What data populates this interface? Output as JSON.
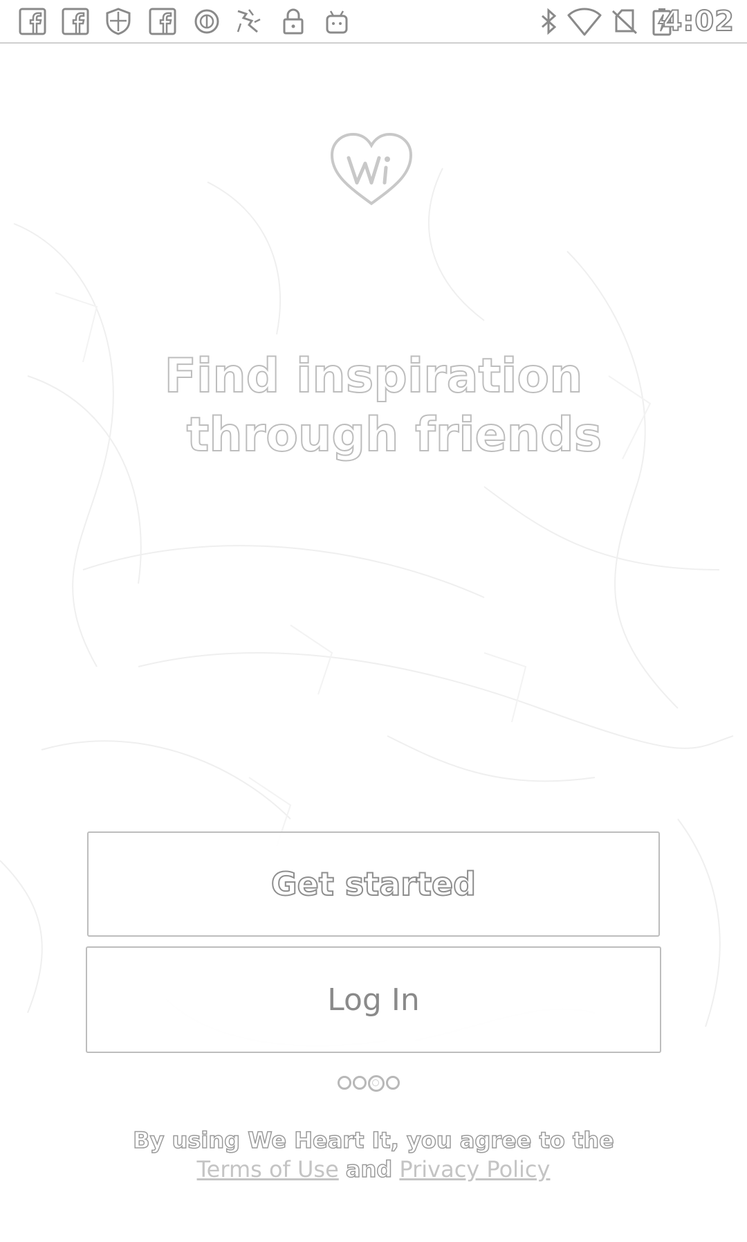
{
  "status_bar": {
    "time": "4:02",
    "left_icons": [
      "facebook-icon",
      "facebook-icon",
      "shield-icon",
      "facebook-icon",
      "circle-icon",
      "fast-app-icon",
      "lock-icon",
      "android-icon"
    ],
    "right_icons": [
      "bluetooth-icon",
      "wifi-icon",
      "no-sim-icon",
      "battery-charging-icon"
    ]
  },
  "brand": {
    "logo_letter": "W"
  },
  "onboarding": {
    "headline_line1": "Find inspiration",
    "headline_line2": "through friends",
    "page_count": 4,
    "active_page": 2
  },
  "actions": {
    "get_started_label": "Get started",
    "log_in_label": "Log In"
  },
  "legal": {
    "line1": "By using We Heart It, you agree to the",
    "terms_label": "Terms of Use",
    "and_text": "and",
    "privacy_label": "Privacy Policy"
  }
}
